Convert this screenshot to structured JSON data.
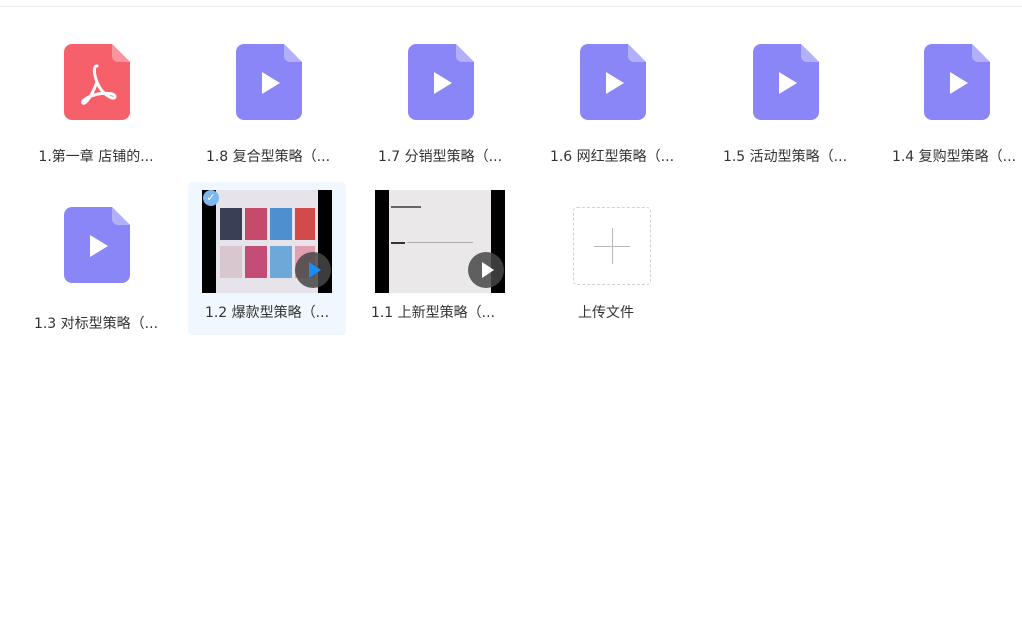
{
  "files": [
    {
      "name": "1.第一章 店铺的...",
      "type": "pdf",
      "color": "#f5606b"
    },
    {
      "name": "1.8 复合型策略（...",
      "type": "video",
      "color": "#8a86f8"
    },
    {
      "name": "1.7 分销型策略（...",
      "type": "video",
      "color": "#8a86f8"
    },
    {
      "name": "1.6 网红型策略（...",
      "type": "video",
      "color": "#8a86f8"
    },
    {
      "name": "1.5 活动型策略（...",
      "type": "video",
      "color": "#8a86f8"
    },
    {
      "name": "1.4 复购型策略（...",
      "type": "video",
      "color": "#8a86f8"
    },
    {
      "name": "1.3 对标型策略（...",
      "type": "video",
      "color": "#8a86f8"
    },
    {
      "name": "1.2 爆款型策略（...",
      "type": "video-thumbnail",
      "selected": true
    },
    {
      "name": "1.1 上新型策略（...",
      "type": "video-thumbnail",
      "selected": false
    }
  ],
  "upload": {
    "label": "上传文件"
  }
}
